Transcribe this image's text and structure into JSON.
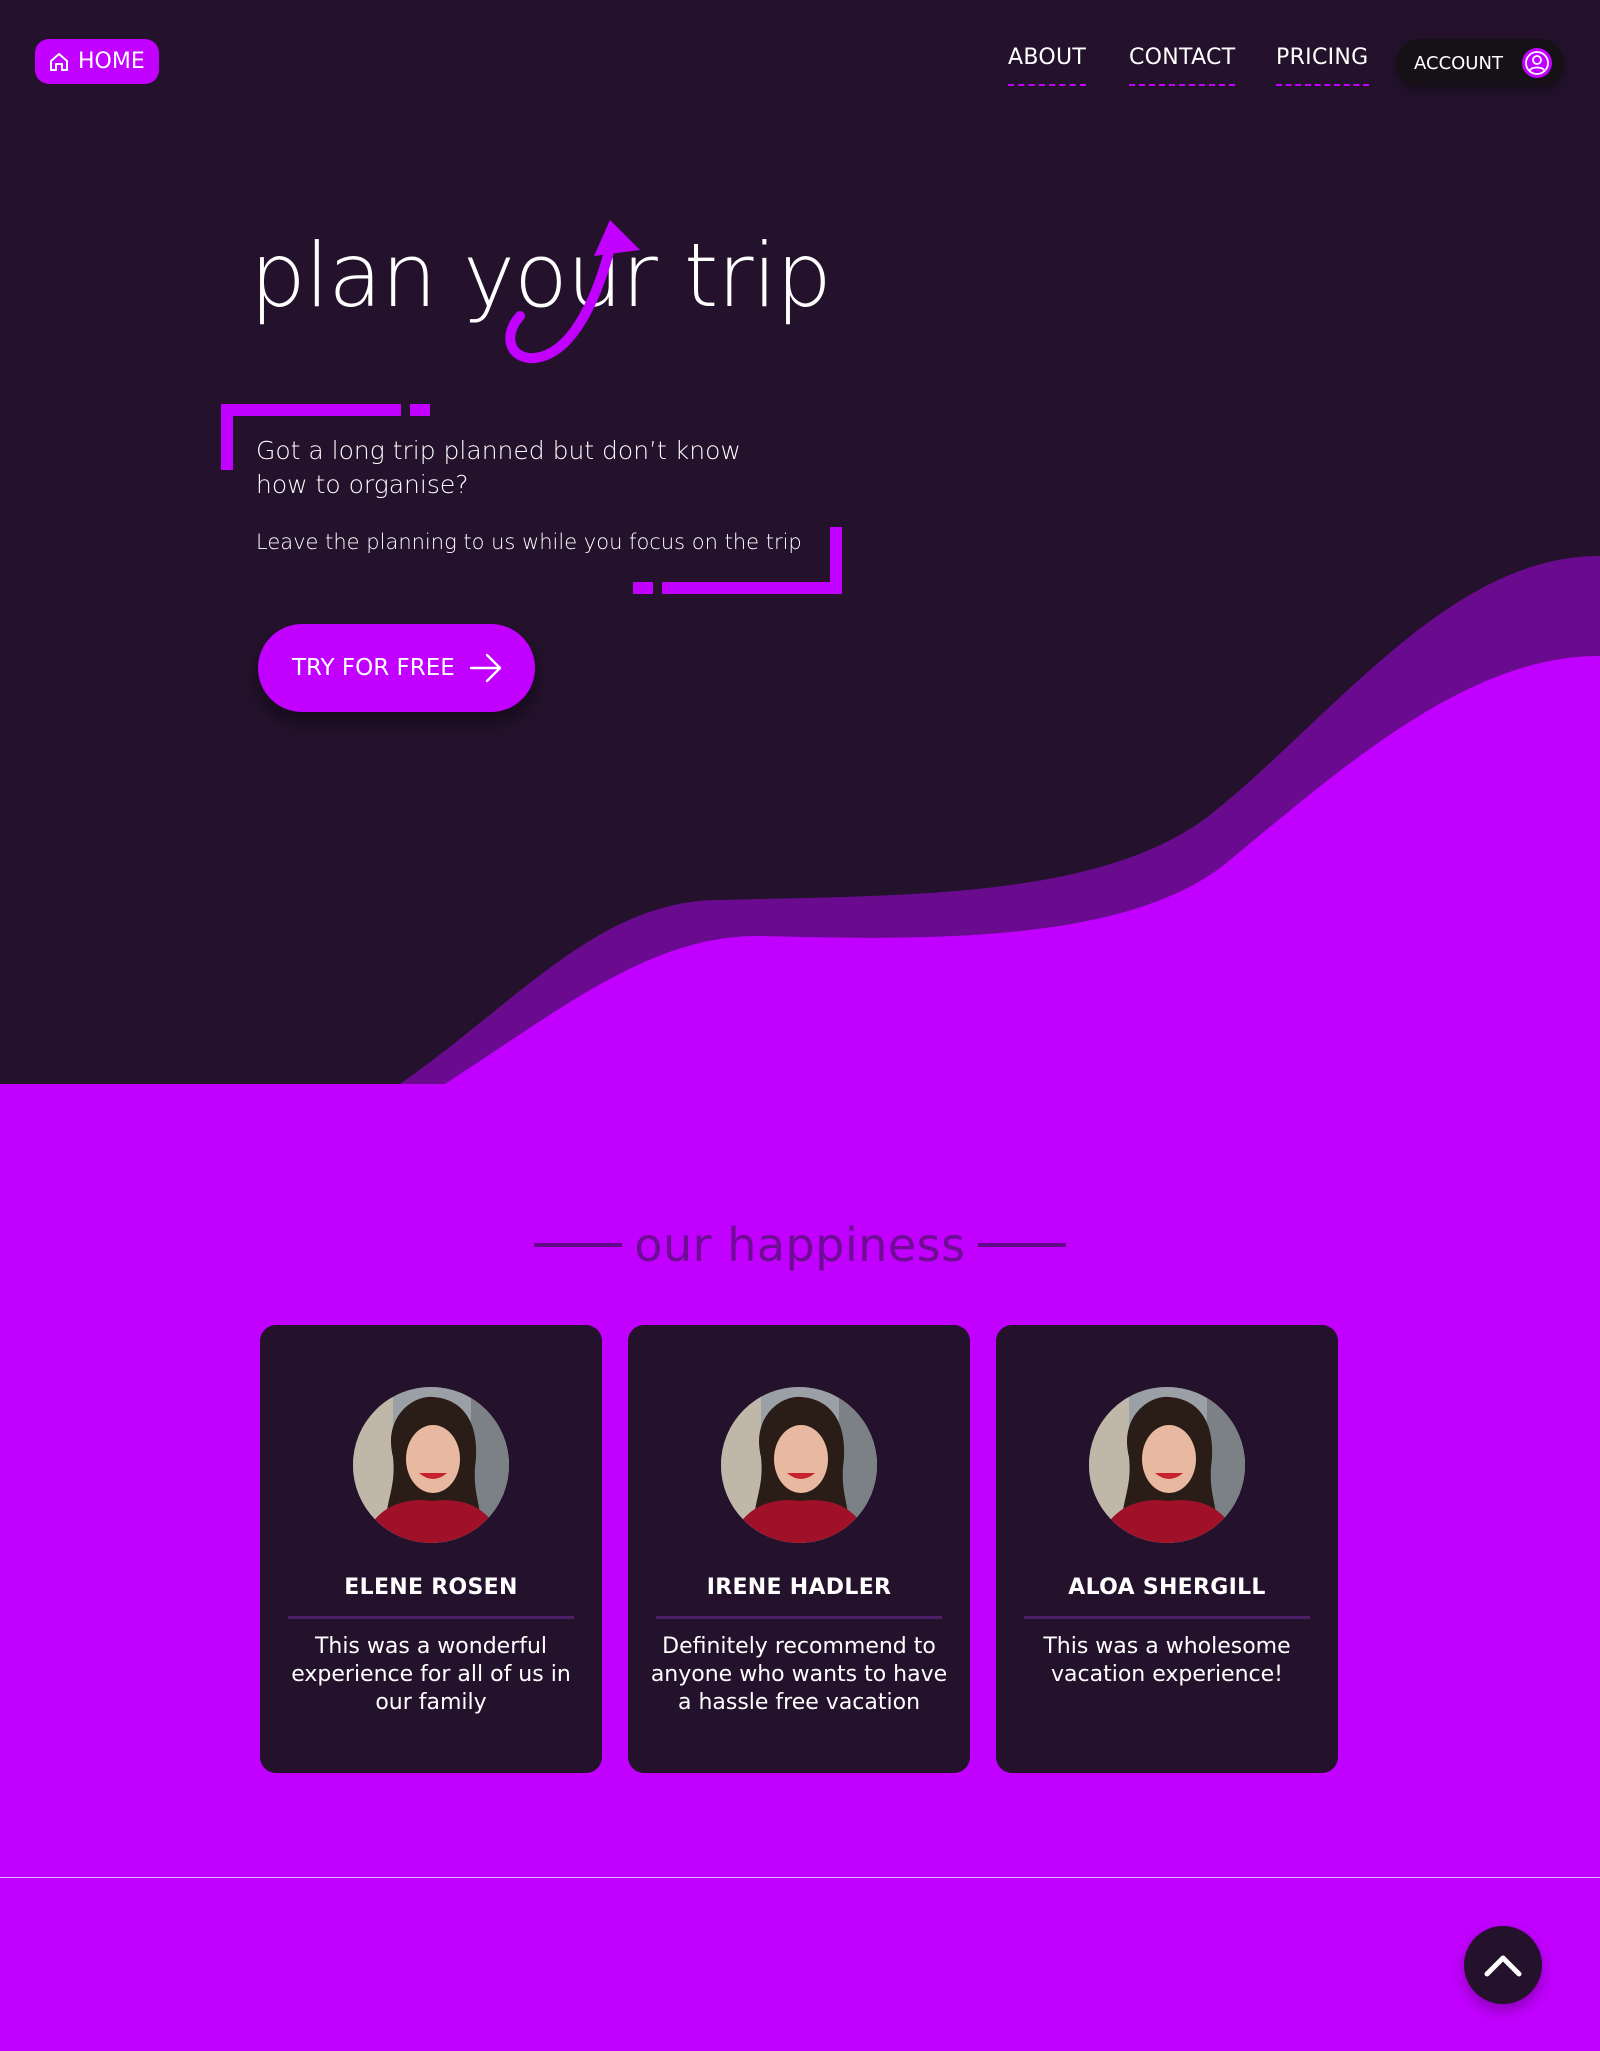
{
  "nav": {
    "home_label": "HOME",
    "links": [
      "ABOUT",
      "CONTACT",
      "PRICING"
    ],
    "account_label": "ACCOUNT"
  },
  "hero": {
    "logo_text": "plan your trip",
    "tagline": "Got a long trip planned but don’t know how to organise?",
    "subline": "Leave the planning to us while you focus on the trip",
    "cta_label": "TRY FOR FREE"
  },
  "testimonials": {
    "heading": "our happiness",
    "items": [
      {
        "name": "ELENE ROSEN",
        "quote": "This was a wonderful experience for all of us in our family"
      },
      {
        "name": "IRENE HADLER",
        "quote": "Definitely recommend to anyone who wants to have a hassle free vacation"
      },
      {
        "name": "ALOA SHERGILL",
        "quote": "This was a wholesome vacation experience!"
      }
    ]
  },
  "icons": {
    "home": "home-icon",
    "account": "user-icon",
    "cta": "arrow-right-icon",
    "back_to_top": "chevron-up-icon"
  },
  "colors": {
    "accent": "#c200ff",
    "dark": "#24122c",
    "wave_mid": "#6a0b8f"
  }
}
